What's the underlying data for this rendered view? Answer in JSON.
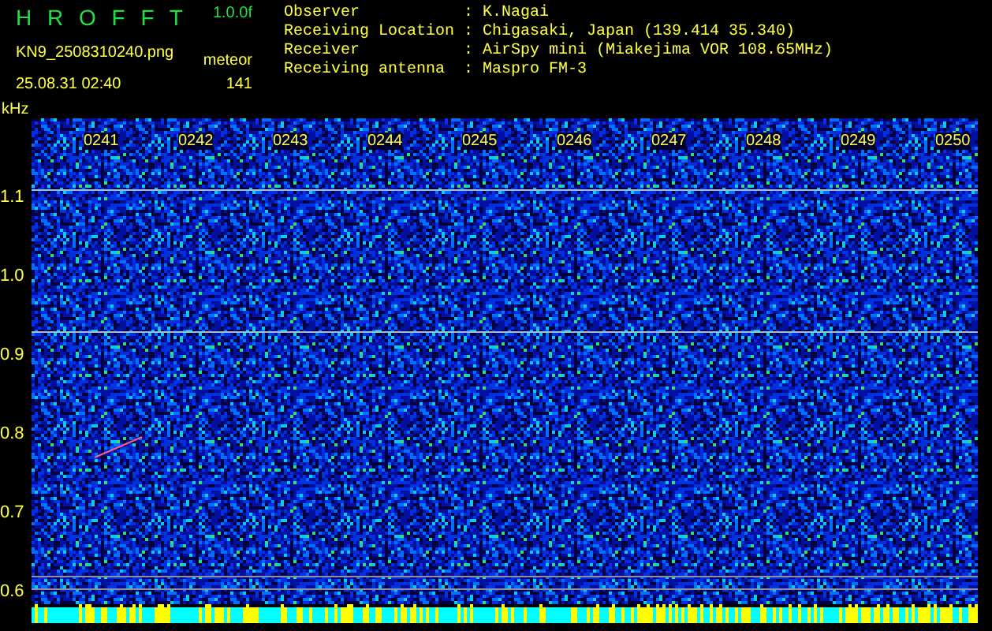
{
  "header": {
    "app_name": "H R O F F T",
    "version": "1.0.0f",
    "file_name": "KN9_2508310240.png",
    "event_type": "meteor",
    "timestamp": "25.08.31 02:40",
    "count": "141",
    "info": [
      {
        "label": "Observer",
        "separator": ":",
        "value": "K.Nagai"
      },
      {
        "label": "Receiving Location",
        "separator": ":",
        "value": "Chigasaki, Japan (139.414 35.340)"
      },
      {
        "label": "Receiver",
        "separator": ":",
        "value": "AirSpy mini (Miakejima VOR 108.65MHz)"
      },
      {
        "label": "Receiving antenna",
        "separator": ":",
        "value": "Maspro FM-3"
      }
    ]
  },
  "spectrogram": {
    "unit": "kHz",
    "time_labels": [
      "0241",
      "0242",
      "0243",
      "0244",
      "0245",
      "0246",
      "0247",
      "0248",
      "0249",
      "0250"
    ],
    "frequency_labels": [
      "1.1",
      "1.0",
      "0.9",
      "0.8",
      "0.7",
      "0.6"
    ]
  }
}
